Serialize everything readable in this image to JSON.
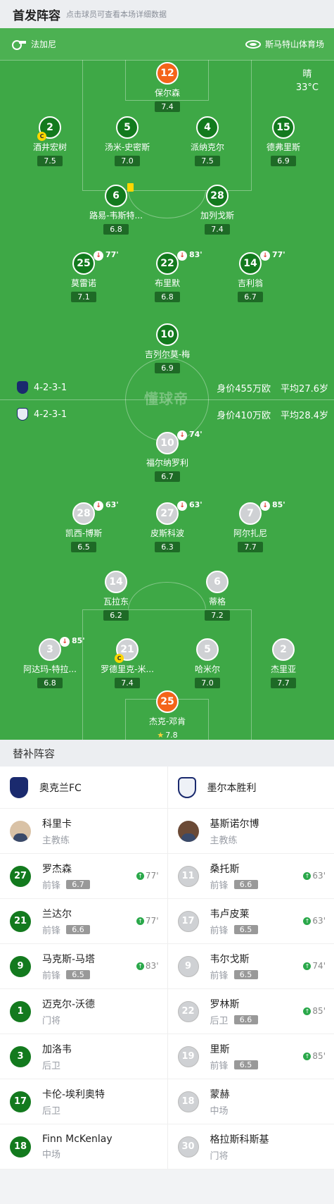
{
  "header": {
    "title": "首发阵容",
    "subtitle": "点击球员可查看本场详细数据"
  },
  "match": {
    "referee": "法加尼",
    "venue": "斯马特山体育场",
    "weather": "晴",
    "temperature": "33°C"
  },
  "home": {
    "formation": "4-2-3-1",
    "value": "身价455万欧",
    "avg_age": "平均27.6岁",
    "color": "#137a1e",
    "players": {
      "gk": {
        "num": "12",
        "name": "保尔森",
        "rating": "7.4"
      },
      "d1": {
        "num": "2",
        "name": "酒井宏树",
        "rating": "7.5",
        "captain": "C"
      },
      "d2": {
        "num": "5",
        "name": "汤米-史密斯",
        "rating": "7.0"
      },
      "d3": {
        "num": "4",
        "name": "派纳克尔",
        "rating": "7.5"
      },
      "d4": {
        "num": "15",
        "name": "德弗里斯",
        "rating": "6.9"
      },
      "m1": {
        "num": "6",
        "name": "路易-韦斯特...",
        "rating": "6.8"
      },
      "m2": {
        "num": "28",
        "name": "加列戈斯",
        "rating": "7.4"
      },
      "a1": {
        "num": "25",
        "name": "莫雷诺",
        "rating": "7.1",
        "sub": "77'"
      },
      "a2": {
        "num": "22",
        "name": "布里默",
        "rating": "6.8",
        "sub": "83'"
      },
      "a3": {
        "num": "14",
        "name": "吉利翁",
        "rating": "6.7",
        "sub": "77'"
      },
      "st": {
        "num": "10",
        "name": "吉列尔莫-梅",
        "rating": "6.9"
      }
    }
  },
  "away": {
    "formation": "4-2-3-1",
    "value": "身价410万欧",
    "avg_age": "平均28.4岁",
    "players": {
      "st": {
        "num": "10",
        "name": "福尔纳罗利",
        "rating": "6.7",
        "sub": "74'"
      },
      "a1": {
        "num": "28",
        "name": "凯西-博斯",
        "rating": "6.5",
        "sub": "63'"
      },
      "a2": {
        "num": "27",
        "name": "皮斯科波",
        "rating": "6.3",
        "sub": "63'"
      },
      "a3": {
        "num": "7",
        "name": "阿尔扎尼",
        "rating": "7.7",
        "sub": "85'"
      },
      "m1": {
        "num": "14",
        "name": "瓦拉东",
        "rating": "6.2"
      },
      "m2": {
        "num": "6",
        "name": "蒂格",
        "rating": "7.2"
      },
      "d1": {
        "num": "3",
        "name": "阿达玛-特拉...",
        "rating": "6.8",
        "sub": "85'"
      },
      "d2": {
        "num": "21",
        "name": "罗德里克-米...",
        "rating": "7.4",
        "captain": "C"
      },
      "d3": {
        "num": "5",
        "name": "哈米尔",
        "rating": "7.0"
      },
      "d4": {
        "num": "2",
        "name": "杰里亚",
        "rating": "7.7"
      },
      "gk": {
        "num": "25",
        "name": "杰克-邓肯",
        "rating": "7.8"
      }
    }
  },
  "watermark": "懂球帝",
  "subs": {
    "title": "替补阵容",
    "home_team": "奥克兰FC",
    "away_team": "墨尔本胜利",
    "home": [
      {
        "kind": "coach",
        "name": "科里卡",
        "pos": "主教练"
      },
      {
        "num": "27",
        "name": "罗杰森",
        "pos": "前锋",
        "rating": "6.7",
        "in": "77'"
      },
      {
        "num": "21",
        "name": "兰达尔",
        "pos": "前锋",
        "rating": "6.6",
        "in": "77'"
      },
      {
        "num": "9",
        "name": "马克斯-马塔",
        "pos": "前锋",
        "rating": "6.5",
        "in": "83'"
      },
      {
        "num": "1",
        "name": "迈克尔-沃德",
        "pos": "门将"
      },
      {
        "num": "3",
        "name": "加洛韦",
        "pos": "后卫"
      },
      {
        "num": "17",
        "name": "卡伦-埃利奥特",
        "pos": "后卫"
      },
      {
        "num": "18",
        "name": "Finn McKenlay",
        "pos": "中场"
      }
    ],
    "away": [
      {
        "kind": "coach",
        "name": "基斯诺尔博",
        "pos": "主教练"
      },
      {
        "num": "11",
        "name": "桑托斯",
        "pos": "前锋",
        "rating": "6.6",
        "in": "63'"
      },
      {
        "num": "17",
        "name": "韦卢皮莱",
        "pos": "前锋",
        "rating": "6.5",
        "in": "63'"
      },
      {
        "num": "9",
        "name": "韦尔戈斯",
        "pos": "前锋",
        "rating": "6.5",
        "in": "74'"
      },
      {
        "num": "22",
        "name": "罗林斯",
        "pos": "后卫",
        "rating": "6.6",
        "in": "85'"
      },
      {
        "num": "19",
        "name": "里斯",
        "pos": "前锋",
        "rating": "6.5",
        "in": "85'"
      },
      {
        "num": "18",
        "name": "蒙赫",
        "pos": "中场"
      },
      {
        "num": "30",
        "name": "格拉斯科斯基",
        "pos": "门将"
      }
    ]
  }
}
